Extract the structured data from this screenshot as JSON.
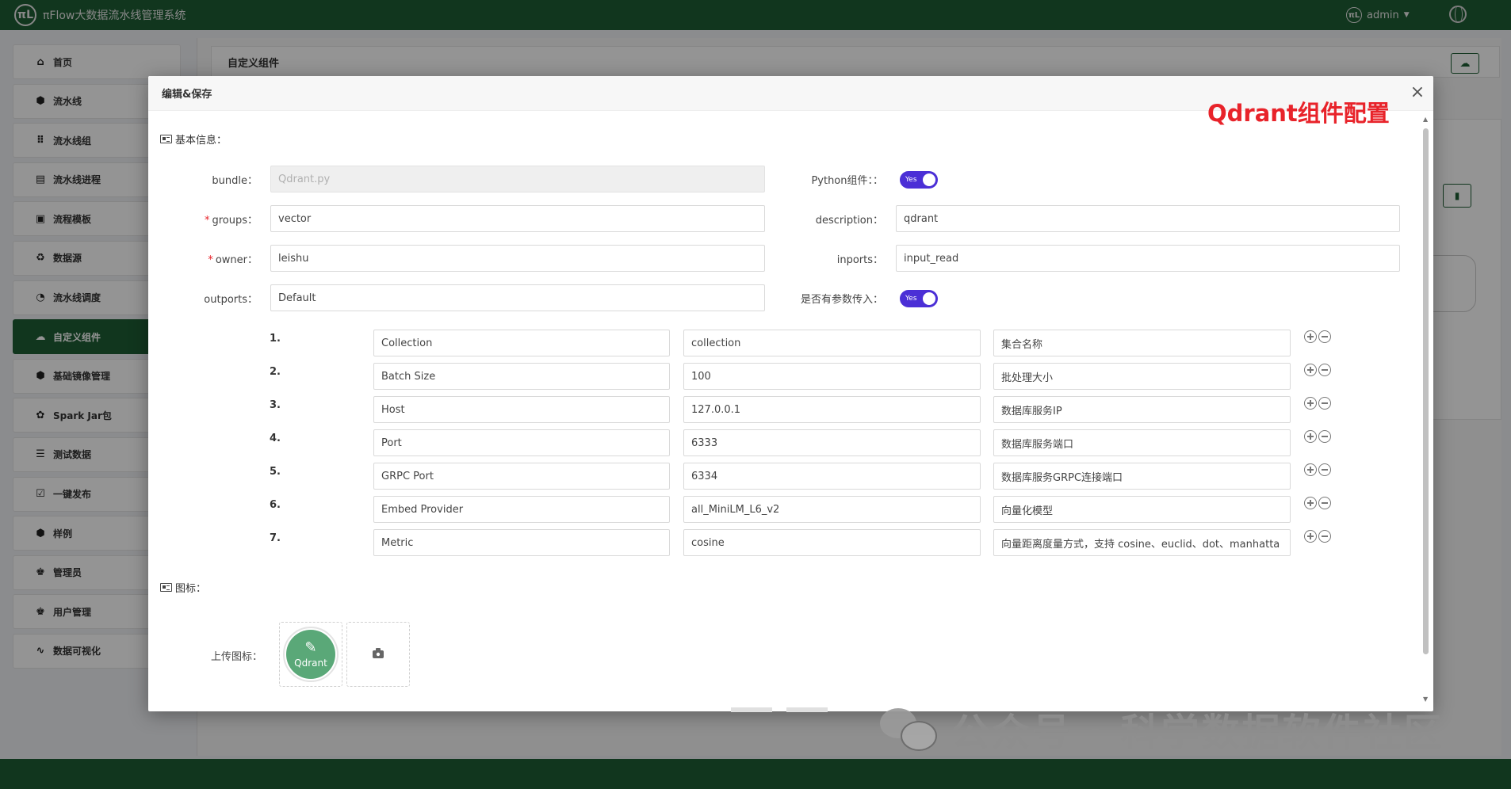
{
  "app": {
    "title": "πFlow大数据流水线管理系统",
    "logo": "πL",
    "user": "admin"
  },
  "sidebar": {
    "items": [
      {
        "label": "首页",
        "icon": "home-icon",
        "glyph": "⌂"
      },
      {
        "label": "流水线",
        "icon": "pipeline-icon",
        "glyph": "⬢"
      },
      {
        "label": "流水线组",
        "icon": "grid-icon",
        "glyph": "⠿"
      },
      {
        "label": "流水线进程",
        "icon": "chart-icon",
        "glyph": "▤"
      },
      {
        "label": "流程模板",
        "icon": "template-icon",
        "glyph": "▣"
      },
      {
        "label": "数据源",
        "icon": "datasource-icon",
        "glyph": "♻"
      },
      {
        "label": "流水线调度",
        "icon": "clock-icon",
        "glyph": "◔"
      },
      {
        "label": "自定义组件",
        "icon": "custom-component-icon",
        "glyph": "☁",
        "active": true
      },
      {
        "label": "基础镜像管理",
        "icon": "image-icon",
        "glyph": "⬢"
      },
      {
        "label": "Spark Jar包",
        "icon": "settings-icon",
        "glyph": "✿"
      },
      {
        "label": "测试数据",
        "icon": "list-icon",
        "glyph": "☰"
      },
      {
        "label": "一键发布",
        "icon": "publish-icon",
        "glyph": "☑"
      },
      {
        "label": "样例",
        "icon": "cube-icon",
        "glyph": "⬢",
        "caret": true
      },
      {
        "label": "管理员",
        "icon": "users-icon",
        "glyph": "♚",
        "caret": true
      },
      {
        "label": "用户管理",
        "icon": "user-manage-icon",
        "glyph": "♚",
        "caret": true
      },
      {
        "label": "数据可视化",
        "icon": "pulse-icon",
        "glyph": "∿",
        "caret": true
      }
    ]
  },
  "page": {
    "header": "自定义组件"
  },
  "modal": {
    "title": "编辑&保存",
    "close": "×",
    "annotation": "Qdrant组件配置",
    "basic_title": "基本信息：",
    "fields": {
      "bundle_label": "bundle：",
      "bundle_value": "Qdrant.py",
      "python_label": "Python组件：：",
      "python_toggle": "Yes",
      "groups_label": "groups：",
      "groups_value": "vector",
      "description_label": "description：",
      "description_value": "qdrant",
      "owner_label": "owner：",
      "owner_value": "leishu",
      "inports_label": "inports：",
      "inports_value": "input_read",
      "outports_label": "outports：",
      "outports_value": "Default",
      "params_label": "是否有参数传入：",
      "params_toggle": "Yes"
    },
    "required_mark": "*",
    "params": [
      {
        "num": "1.",
        "name": "Collection",
        "value": "collection",
        "desc": "集合名称"
      },
      {
        "num": "2.",
        "name": "Batch Size",
        "value": "100",
        "desc": "批处理大小"
      },
      {
        "num": "3.",
        "name": "Host",
        "value": "127.0.0.1",
        "desc": "数据库服务IP"
      },
      {
        "num": "4.",
        "name": "Port",
        "value": "6333",
        "desc": "数据库服务端口"
      },
      {
        "num": "5.",
        "name": "GRPC Port",
        "value": "6334",
        "desc": "数据库服务GRPC连接端口"
      },
      {
        "num": "6.",
        "name": "Embed Provider",
        "value": "all_MiniLM_L6_v2",
        "desc": "向量化模型"
      },
      {
        "num": "7.",
        "name": "Metric",
        "value": "cosine",
        "desc": "向量距离度量方式，支持 cosine、euclid、dot、manhatta"
      }
    ],
    "icon_title": "图标：",
    "upload_label": "上传图标：",
    "qdrant_icon_text": "Qdrant"
  },
  "watermark": {
    "text": "公众号 · 科学数据软件社区"
  },
  "colors": {
    "brand_green": "#1e5e34",
    "toggle_purple": "#4b2fd6",
    "annotation_red": "#e8232a",
    "icon_green": "#5aa878"
  }
}
